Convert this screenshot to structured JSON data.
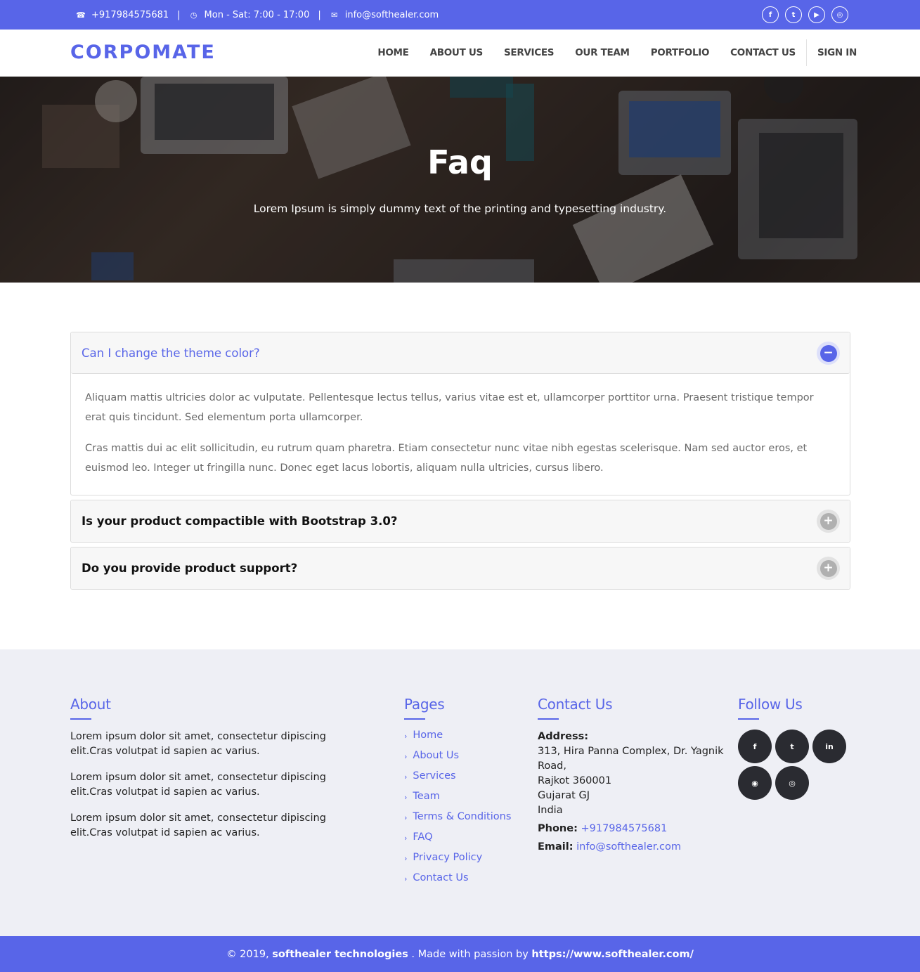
{
  "topbar": {
    "phone": "+917984575681",
    "hours": "Mon - Sat: 7:00 - 17:00",
    "email": "info@softhealer.com",
    "separator": "|",
    "socials": [
      {
        "icon": "facebook-icon",
        "glyph": "f"
      },
      {
        "icon": "twitter-icon",
        "glyph": "t"
      },
      {
        "icon": "youtube-icon",
        "glyph": "▶"
      },
      {
        "icon": "instagram-icon",
        "glyph": "◎"
      }
    ]
  },
  "nav": {
    "logo": "CORPOMATE",
    "items": [
      "HOME",
      "ABOUT US",
      "SERVICES",
      "OUR TEAM",
      "PORTFOLIO",
      "CONTACT US"
    ],
    "signin": "SIGN IN"
  },
  "hero": {
    "title": "Faq",
    "subtitle": "Lorem Ipsum is simply dummy text of the printing and typesetting industry."
  },
  "faq": [
    {
      "question": "Can I change the theme color?",
      "open": true,
      "paragraphs": [
        "Aliquam mattis ultricies dolor ac vulputate. Pellentesque lectus tellus, varius vitae est et, ullamcorper porttitor urna. Praesent tristique tempor erat quis tincidunt. Sed elementum porta ullamcorper.",
        "Cras mattis dui ac elit sollicitudin, eu rutrum quam pharetra. Etiam consectetur nunc vitae nibh egestas scelerisque. Nam sed auctor eros, et euismod leo. Integer ut fringilla nunc. Donec eget lacus lobortis, aliquam nulla ultricies, cursus libero."
      ],
      "toggle": "−"
    },
    {
      "question": "Is your product compactible with Bootstrap 3.0?",
      "open": false,
      "toggle": "+"
    },
    {
      "question": "Do you provide product support?",
      "open": false,
      "toggle": "+"
    }
  ],
  "footer": {
    "about": {
      "title": "About",
      "paragraphs": [
        "Lorem ipsum dolor sit amet, consectetur dipiscing elit.Cras volutpat id sapien ac varius.",
        "Lorem ipsum dolor sit amet, consectetur dipiscing elit.Cras volutpat id sapien ac varius.",
        "Lorem ipsum dolor sit amet, consectetur dipiscing elit.Cras volutpat id sapien ac varius."
      ]
    },
    "pages": {
      "title": "Pages",
      "links": [
        "Home",
        "About Us",
        "Services",
        "Team",
        "Terms & Conditions",
        "FAQ",
        "Privacy Policy",
        "Contact Us"
      ]
    },
    "contact": {
      "title": "Contact Us",
      "address_label": "Address:",
      "address_lines": [
        "313, Hira Panna Complex, Dr. Yagnik",
        "Road,",
        "Rajkot 360001",
        "Gujarat GJ",
        "India"
      ],
      "phone_label": "Phone:",
      "phone": "+917984575681",
      "email_label": "Email:",
      "email": "info@softhealer.com"
    },
    "follow": {
      "title": "Follow Us",
      "buttons": [
        {
          "icon": "facebook-icon",
          "glyph": "f"
        },
        {
          "icon": "twitter-icon",
          "glyph": "t"
        },
        {
          "icon": "linkedin-icon",
          "glyph": "in"
        },
        {
          "icon": "github-icon",
          "glyph": "◉"
        },
        {
          "icon": "instagram-icon",
          "glyph": "◎"
        }
      ]
    }
  },
  "bottom": {
    "prefix": "© 2019,",
    "company": "softhealer technologies",
    "middle": ". Made with passion by",
    "url": "https://www.softhealer.com/"
  },
  "colors": {
    "accent": "#5865e8",
    "footer_bg": "#eeeff5",
    "dark_button": "#2a2b31"
  }
}
